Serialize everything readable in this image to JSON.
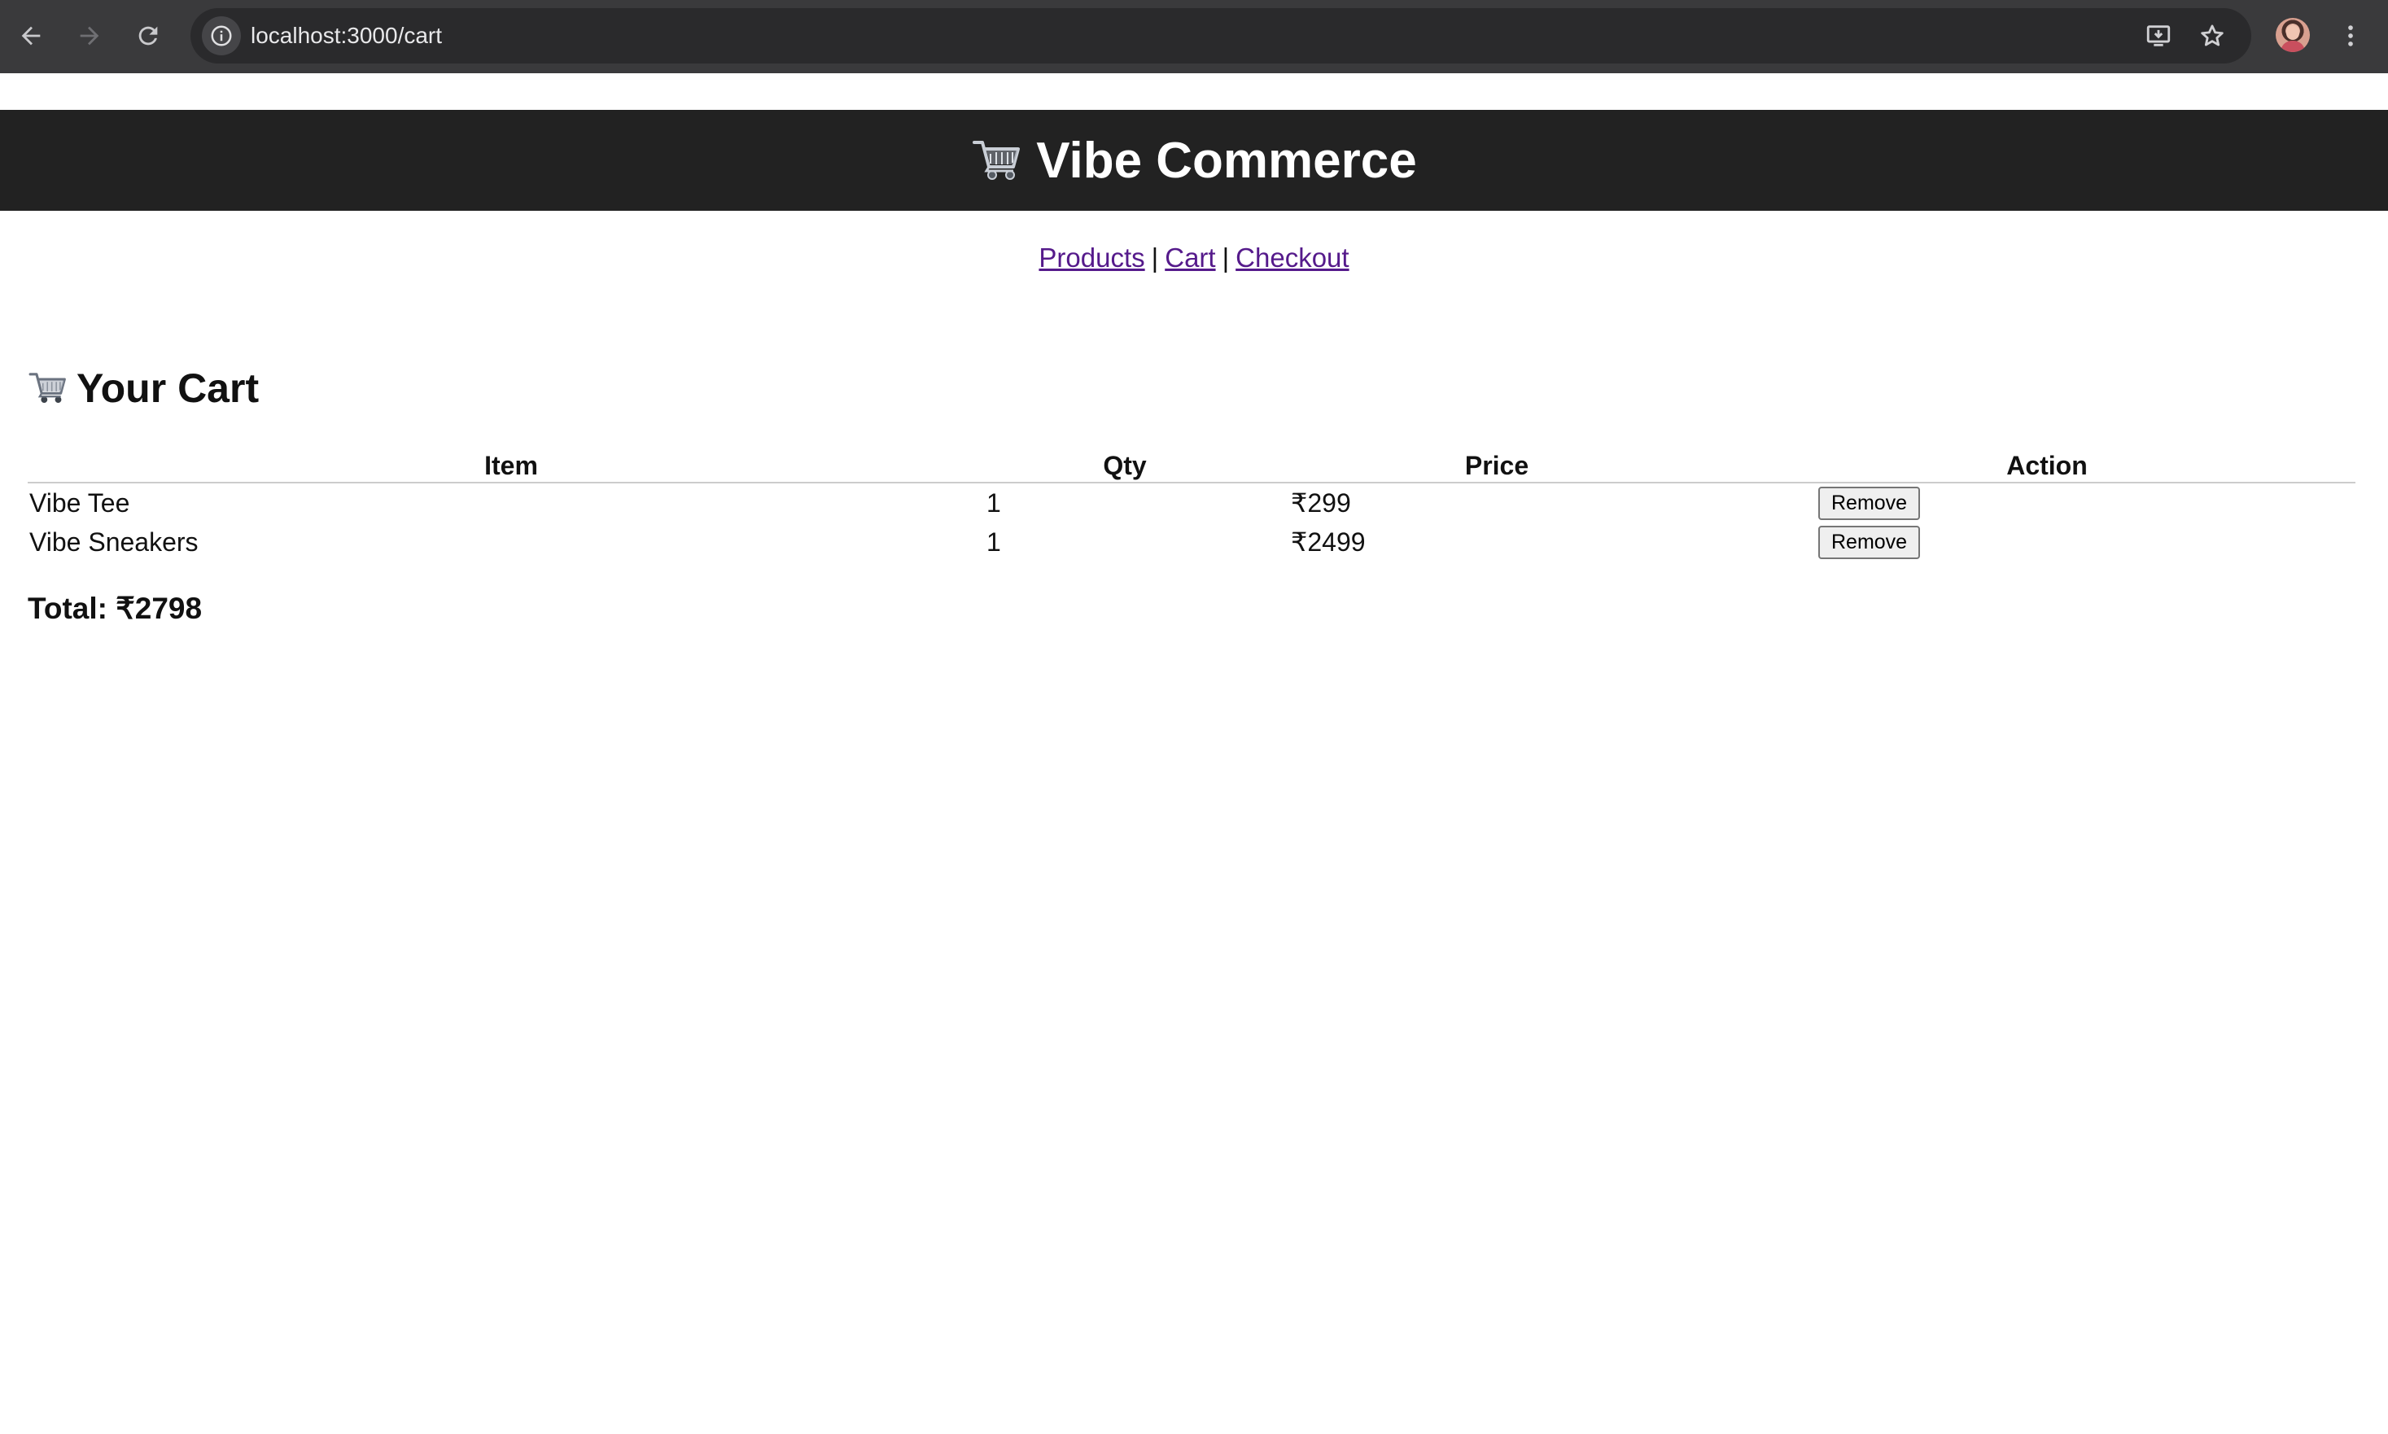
{
  "browser": {
    "url": "localhost:3000/cart",
    "back_icon": "arrow-left",
    "forward_icon": "arrow-right",
    "reload_icon": "reload",
    "site_info_icon": "info",
    "install_icon": "install-app",
    "bookmark_icon": "star",
    "menu_icon": "kebab-menu"
  },
  "header": {
    "title": "Vibe Commerce",
    "background": "#222222"
  },
  "nav": {
    "products": "Products",
    "separator1": "|",
    "cart": "Cart",
    "separator2": "|",
    "checkout": "Checkout",
    "link_color": "#551a8b"
  },
  "cart": {
    "heading": "Your Cart",
    "columns": {
      "item": "Item",
      "qty": "Qty",
      "price": "Price",
      "action": "Action"
    },
    "rows": [
      {
        "item": "Vibe Tee",
        "qty": "1",
        "price": "₹299",
        "action": "Remove"
      },
      {
        "item": "Vibe Sneakers",
        "qty": "1",
        "price": "₹2499",
        "action": "Remove"
      }
    ],
    "total": "Total: ₹2798"
  }
}
